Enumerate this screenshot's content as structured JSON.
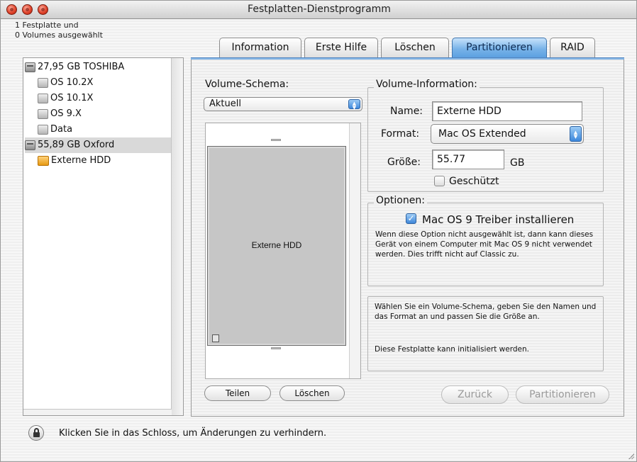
{
  "window": {
    "title": "Festplatten-Dienstprogramm"
  },
  "sidebar": {
    "selection_line1": "1 Festplatte und",
    "selection_line2": "0 Volumes ausgewählt",
    "items": [
      {
        "label": "27,95 GB TOSHIBA",
        "icon": "disk-icon"
      },
      {
        "label": "OS 10.2X",
        "icon": "volume-icon"
      },
      {
        "label": "OS 10.1X",
        "icon": "volume-icon"
      },
      {
        "label": "OS 9.X",
        "icon": "volume-icon"
      },
      {
        "label": "Data",
        "icon": "volume-icon"
      },
      {
        "label": "55,89 GB Oxford",
        "icon": "disk-icon"
      },
      {
        "label": "Externe HDD",
        "icon": "external-volume-icon"
      }
    ]
  },
  "tabs": [
    "Information",
    "Erste Hilfe",
    "Löschen",
    "Partitionieren",
    "RAID"
  ],
  "active_tab": "Partitionieren",
  "scheme": {
    "label": "Volume-Schema:",
    "selected": "Aktuell",
    "partition_name": "Externe HDD"
  },
  "volume_info": {
    "group_label": "Volume-Information:",
    "name_label": "Name:",
    "name_value": "Externe HDD",
    "format_label": "Format:",
    "format_value": "Mac OS Extended",
    "size_label": "Größe:",
    "size_value": "55.77",
    "size_unit": "GB",
    "protected_label": "Geschützt"
  },
  "options": {
    "group_label": "Optionen:",
    "driver_label": "Mac OS 9 Treiber installieren",
    "driver_checked": true,
    "help_text": "Wenn diese Option nicht ausgewählt ist, dann kann dieses Gerät von einem Computer mit Mac OS 9 nicht verwendet werden. Dies trifft nicht auf Classic zu."
  },
  "instructions": {
    "line1": "Wählen Sie ein Volume-Schema, geben Sie den Namen und das Format an und passen Sie die Größe an.",
    "line2": "Diese Festplatte kann initialisiert werden."
  },
  "buttons": {
    "split": "Teilen",
    "delete": "Löschen",
    "revert": "Zurück",
    "partition": "Partitionieren"
  },
  "status_text": "Klicken Sie in das Schloss, um Änderungen zu verhindern.",
  "colors": {
    "accent": "#5a9fe0",
    "close": "#e0442c"
  }
}
